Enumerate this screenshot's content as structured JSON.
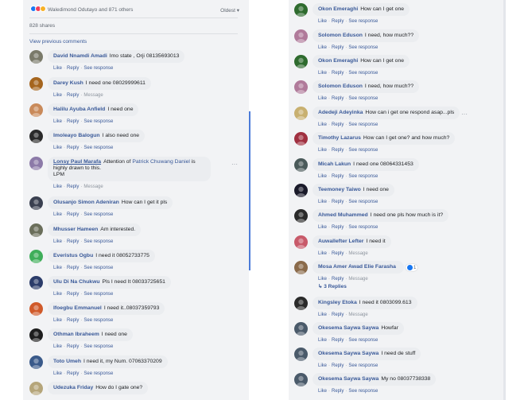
{
  "left": {
    "reactors": "Waledimond Odutayo and 871 others",
    "sort_label": "Oldest ▾",
    "shares": "828 shares",
    "view_previous": "View previous comments",
    "comments": [
      {
        "author": "David Nnamdi Amadi",
        "text": "Imo state , Orji 08135693013",
        "actions": [
          "Like",
          "Reply",
          "See response"
        ],
        "avatar": "#7a7a6a"
      },
      {
        "author": "Darey Kush",
        "text": "I need one 08029999611",
        "actions": [
          "Like",
          "Reply",
          "Message"
        ],
        "avatar": "#a5651e"
      },
      {
        "author": "Halilu Ayuba Anfield",
        "text": "I need one",
        "actions": [
          "Like",
          "Reply",
          "See response"
        ],
        "avatar": "#c98a5a"
      },
      {
        "author": "Imoleayo Balogun",
        "text": "I also need one",
        "actions": [
          "Like",
          "Reply",
          "See response"
        ],
        "avatar": "#2a2a2a"
      },
      {
        "author": "Lonsy Paul Marafa",
        "text_pre": "Attention of",
        "mention": "Patrick Chuwang Daniel",
        "text_post": "is highly drawn to this.",
        "text_line3": "LPM",
        "actions": [
          "Like",
          "Reply",
          "Message"
        ],
        "avatar": "#8c7aa8"
      },
      {
        "author": "Olusanjo Simon Adeniran",
        "text": "How can I get it pls",
        "actions": [
          "Like",
          "Reply",
          "See response"
        ],
        "avatar": "#3a4050"
      },
      {
        "author": "Mhusser Hameen",
        "text": "Am interested.",
        "actions": [
          "Like",
          "Reply",
          "See response"
        ],
        "avatar": "#6a6e5a"
      },
      {
        "author": "Everistus Ogbu",
        "text": "I need it 08052733775",
        "actions": [
          "Like",
          "Reply",
          "See response"
        ],
        "avatar": "#3fae5a"
      },
      {
        "author": "Ulu Di Na Chukwu",
        "text": "Pls I need It 08033725651",
        "actions": [
          "Like",
          "Reply",
          "See response"
        ],
        "avatar": "#2b3c6a"
      },
      {
        "author": "Ifoegbu Emmanuel",
        "text": "I need it..08037359793",
        "actions": [
          "Like",
          "Reply",
          "See response"
        ],
        "avatar": "#d05a2a"
      },
      {
        "author": "Othman Ibraheem",
        "text": "I need one",
        "actions": [
          "Like",
          "Reply",
          "See response"
        ],
        "avatar": "#1e1e1e"
      },
      {
        "author": "Toto Umeh",
        "text": "I need it, my Num. 07063370209",
        "actions": [
          "Like",
          "Reply",
          "See response"
        ],
        "avatar": "#3a5a8a"
      },
      {
        "author": "Udezuka Friday",
        "text": "How do I gate one?",
        "actions": [],
        "avatar": "#b5a57a"
      }
    ]
  },
  "right": {
    "comments": [
      {
        "author": "Okon Emeraghi",
        "text": "How can I get one",
        "actions": [
          "Like",
          "Reply",
          "See response"
        ],
        "avatar": "#2e6b2e"
      },
      {
        "author": "Solomon Eduson",
        "text": "I need, how much??",
        "actions": [
          "Like",
          "Reply",
          "See response"
        ],
        "avatar": "#b07a9a"
      },
      {
        "author": "Okon Emeraghi",
        "text": "How can I get one",
        "actions": [
          "Like",
          "Reply",
          "See response"
        ],
        "avatar": "#2e6b2e"
      },
      {
        "author": "Solomon Eduson",
        "text": "I need, how much??",
        "actions": [
          "Like",
          "Reply",
          "See response"
        ],
        "avatar": "#b07a9a"
      },
      {
        "author": "Adedeji Adeyinka",
        "text": "How can i get one respond asap...pls",
        "actions": [
          "Like",
          "Reply",
          "See response"
        ],
        "avatar": "#c8b070"
      },
      {
        "author": "Timothy Lazarus",
        "text": "How can I get one? and how much?",
        "actions": [
          "Like",
          "Reply",
          "See response"
        ],
        "avatar": "#a03040"
      },
      {
        "author": "Micah Lakun",
        "text": "I need one 08064331453",
        "actions": [
          "Like",
          "Reply",
          "See response"
        ],
        "avatar": "#4a5a5a"
      },
      {
        "author": "Teemoney Taiwo",
        "text": "I need one",
        "actions": [
          "Like",
          "Reply",
          "See response"
        ],
        "avatar": "#1a1a2a"
      },
      {
        "author": "Ahmed Muhammed",
        "text": "I need one pls how much is it?",
        "actions": [
          "Like",
          "Reply",
          "See response"
        ],
        "avatar": "#2a2a2a"
      },
      {
        "author": "Auwallefter Lefter",
        "text": "I need it",
        "actions": [
          "Like",
          "Reply",
          "Message"
        ],
        "avatar": "#c85a6a"
      },
      {
        "author": "Mosa Amer Awad Elie Farasha",
        "text": "",
        "actions": [
          "Like",
          "Reply",
          "Message"
        ],
        "avatar": "#8a6a4a",
        "reaction_count": "1",
        "replies": "3 Replies"
      },
      {
        "author": "Kingsley Etoka",
        "text": "I need it 0803099.613",
        "actions": [
          "Like",
          "Reply",
          "Message"
        ],
        "avatar": "#2a2a2a"
      },
      {
        "author": "Okesema Saywa Saywa",
        "text": "Howfar",
        "actions": [
          "Like",
          "Reply",
          "See response"
        ],
        "avatar": "#4a5a6a"
      },
      {
        "author": "Okesema Saywa Saywa",
        "text": "I need de stuff",
        "actions": [
          "Like",
          "Reply",
          "See response"
        ],
        "avatar": "#4a5a6a"
      },
      {
        "author": "Okesema Saywa Saywa",
        "text": "My no 08037738338",
        "actions": [
          "Like",
          "Reply",
          "See response"
        ],
        "avatar": "#4a5a6a"
      }
    ]
  }
}
